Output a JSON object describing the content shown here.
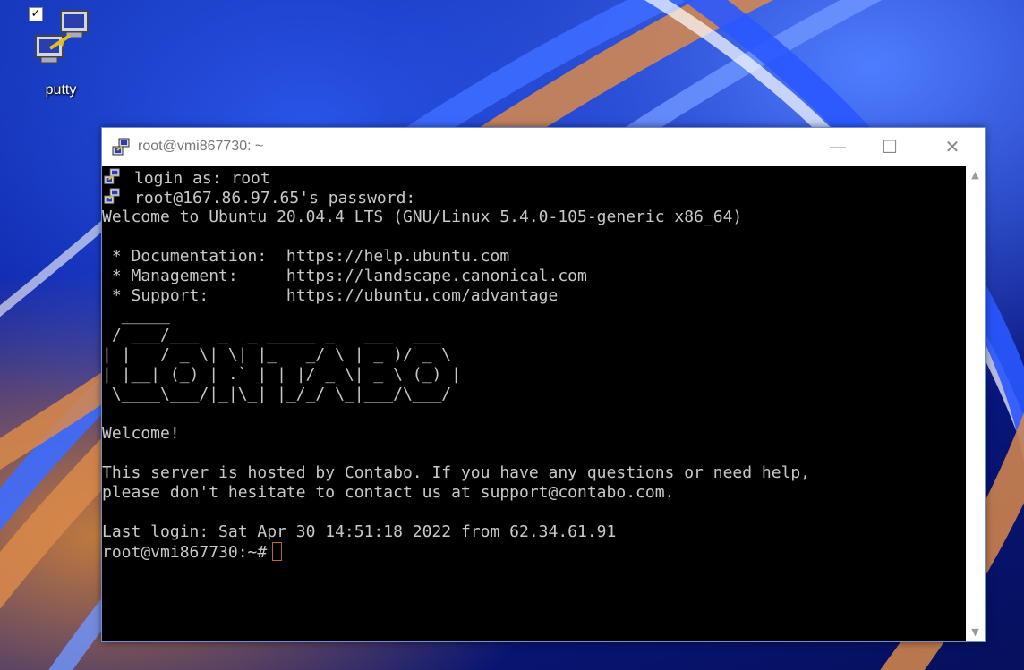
{
  "desktop": {
    "icons": [
      {
        "label": "putty",
        "checked": true,
        "icon": "putty-icon"
      }
    ]
  },
  "window": {
    "title": "root@vmi867730: ~",
    "controls": {
      "minimize": "—",
      "maximize": "☐",
      "close": "✕"
    },
    "scroll": {
      "up": "▲",
      "down": "▼"
    }
  },
  "terminal": {
    "text_color": "#c8c8c8",
    "background": "#000000",
    "cursor_color": "#b86a2a",
    "lines": [
      {
        "icon": "putty-icon",
        "text": "login as: root"
      },
      {
        "icon": "putty-icon",
        "text": "root@167.86.97.65's password:"
      },
      {
        "text": "Welcome to Ubuntu 20.04.4 LTS (GNU/Linux 5.4.0-105-generic x86_64)"
      },
      {
        "text": ""
      },
      {
        "text": " * Documentation:  https://help.ubuntu.com"
      },
      {
        "text": " * Management:     https://landscape.canonical.com"
      },
      {
        "text": " * Support:        https://ubuntu.com/advantage"
      },
      {
        "text": "  _____"
      },
      {
        "text": " / ___/___  _  _ _____ _   ___  ___"
      },
      {
        "text": "| |   / _ \\| \\| |_   _/ \\ | _ )/ _ \\"
      },
      {
        "text": "| |__| (_) | .` | | |/ _ \\| _ \\ (_) |"
      },
      {
        "text": " \\____\\___/|_|\\_| |_/_/ \\_|___/\\___/"
      },
      {
        "text": ""
      },
      {
        "text": "Welcome!"
      },
      {
        "text": ""
      },
      {
        "text": "This server is hosted by Contabo. If you have any questions or need help,"
      },
      {
        "text": "please don't hesitate to contact us at support@contabo.com."
      },
      {
        "text": ""
      },
      {
        "text": "Last login: Sat Apr 30 14:51:18 2022 from 62.34.61.91"
      }
    ],
    "prompt": "root@vmi867730:~#"
  }
}
